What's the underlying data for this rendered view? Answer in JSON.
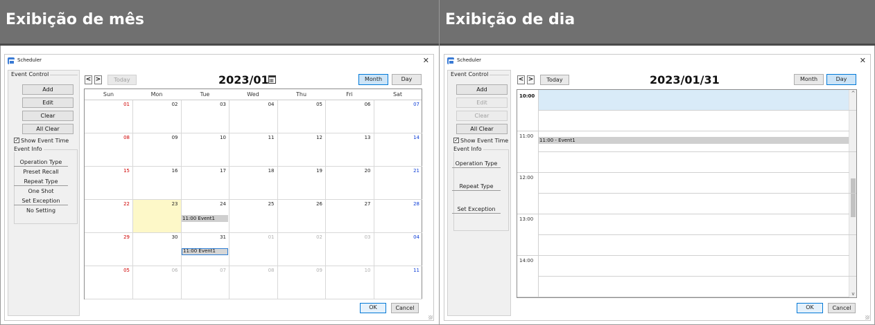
{
  "panels": {
    "month_header": "Exibição de mês",
    "day_header": "Exibição de dia"
  },
  "window": {
    "title": "Scheduler",
    "close": "✕"
  },
  "sidebar": {
    "event_control_label": "Event Control",
    "add": "Add",
    "edit": "Edit",
    "clear": "Clear",
    "all_clear": "All Clear",
    "show_event_time": "Show Event Time",
    "show_event_time_checked": true,
    "event_info_label": "Event Info",
    "operation_type_label": "Operation Type",
    "repeat_type_label": "Repeat Type",
    "set_exception_label": "Set Exception"
  },
  "month_view": {
    "event_info_values": {
      "operation_type": "Preset Recall",
      "repeat_type": "One Shot",
      "set_exception": "No Setting"
    },
    "prev": "<",
    "next": ">",
    "today_label": "Today",
    "title": "2023/01",
    "month_label": "Month",
    "day_label": "Day",
    "active_view": "Month",
    "weekdays": [
      "Sun",
      "Mon",
      "Tue",
      "Wed",
      "Thu",
      "Fri",
      "Sat"
    ],
    "weeks": [
      [
        "01",
        "02",
        "03",
        "04",
        "05",
        "06",
        "07"
      ],
      [
        "08",
        "09",
        "10",
        "11",
        "12",
        "13",
        "14"
      ],
      [
        "15",
        "16",
        "17",
        "18",
        "19",
        "20",
        "21"
      ],
      [
        "22",
        "23",
        "24",
        "25",
        "26",
        "27",
        "28"
      ],
      [
        "29",
        "30",
        "31",
        "01",
        "02",
        "03",
        "04"
      ],
      [
        "05",
        "06",
        "07",
        "08",
        "09",
        "10",
        "11"
      ]
    ],
    "events": [
      {
        "week": 3,
        "day": 2,
        "text": "11:00 Event1",
        "selected": false
      },
      {
        "week": 4,
        "day": 2,
        "text": "11:00 Event1",
        "selected": true
      }
    ],
    "ok": "OK",
    "cancel": "Cancel"
  },
  "day_view": {
    "prev": "<",
    "next": ">",
    "today_label": "Today",
    "title": "2023/01/31",
    "month_label": "Month",
    "day_label": "Day",
    "active_view": "Day",
    "time_labels": [
      "10:00",
      "11:00",
      "12:00",
      "13:00",
      "14:00"
    ],
    "event": "11:00 - Event1",
    "scroll_up": "^",
    "scroll_down": "v",
    "ok": "OK",
    "cancel": "Cancel"
  },
  "colors": {
    "header_bg": "#707070",
    "sunday": "#d00000",
    "saturday": "#0a3bd6",
    "today_highlight": "#fdf8c8",
    "selection_blue": "#0078d7"
  }
}
